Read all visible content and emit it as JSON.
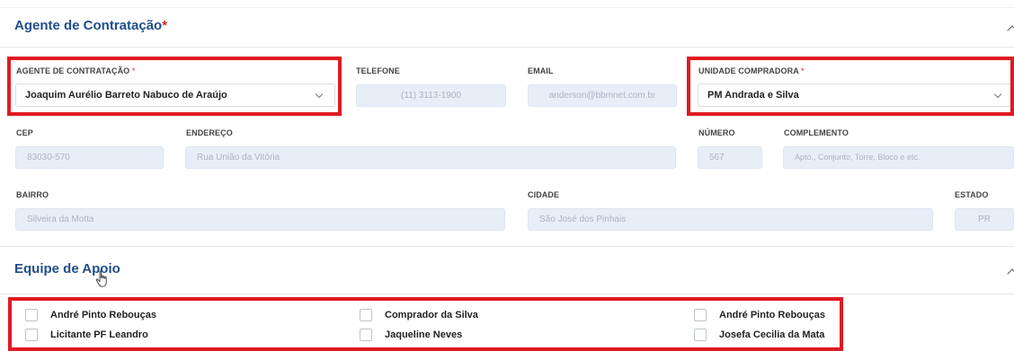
{
  "agent_section": {
    "title": "Agente de Contratação",
    "required_mark": "*"
  },
  "fields": {
    "agente": {
      "label": "AGENTE DE CONTRATAÇÃO",
      "required_mark": "*",
      "value": "Joaquim Aurélio Barreto Nabuco de Araújo"
    },
    "telefone": {
      "label": "TELEFONE",
      "value": "(11) 3113-1900"
    },
    "email": {
      "label": "EMAIL",
      "value": "anderson@bbmnet.com.br"
    },
    "unidade": {
      "label": "UNIDADE COMPRADORA",
      "required_mark": "*",
      "value": "PM Andrada e Silva"
    },
    "cep": {
      "label": "CEP",
      "value": "83030-570"
    },
    "endereco": {
      "label": "ENDEREÇO",
      "value": "Rua União da Vitória"
    },
    "numero": {
      "label": "NÚMERO",
      "value": "567"
    },
    "complemento": {
      "label": "COMPLEMENTO",
      "value": "Apto., Conjunto, Torre, Bloco e etc."
    },
    "bairro": {
      "label": "BAIRRO",
      "value": "Silveira da Motta"
    },
    "cidade": {
      "label": "CIDADE",
      "value": "São José dos Pinhais"
    },
    "estado": {
      "label": "ESTADO",
      "value": "PR"
    }
  },
  "equipe_section": {
    "title": "Equipe de Apoio"
  },
  "equipe": [
    {
      "name": "André Pinto Rebouças",
      "checked": false
    },
    {
      "name": "Comprador da Silva",
      "checked": false
    },
    {
      "name": "André Pinto Rebouças",
      "checked": false
    },
    {
      "name": "Licitante PF Leandro",
      "checked": false
    },
    {
      "name": "Jaqueline Neves",
      "checked": false
    },
    {
      "name": "Josefa Cecilia da Mata",
      "checked": false
    }
  ],
  "icons": {
    "collapse": "chevron-up-icon",
    "dropdown": "chevron-down-icon",
    "cursor": "hand-cursor-icon"
  },
  "colors": {
    "title": "#1f4e8c",
    "highlight": "#e01a22",
    "readonly_field": "#e8eef7"
  }
}
